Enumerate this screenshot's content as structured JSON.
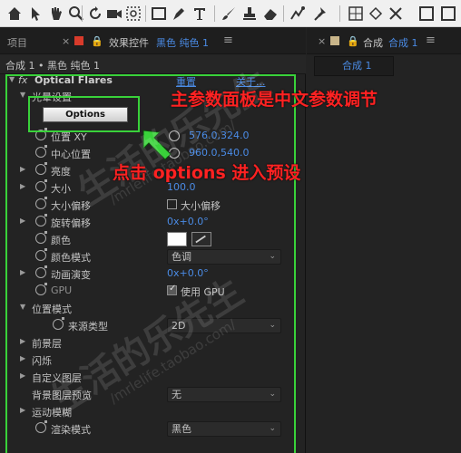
{
  "toolbar": {
    "tools": [
      "home-icon",
      "hand-icon",
      "zoom-icon",
      "rotate-icon",
      "camera-icon",
      "pan-behind-icon",
      "rectangle-icon",
      "pen-icon",
      "text-icon",
      "brush-icon",
      "clone-stamp-icon",
      "eraser-icon",
      "roto-brush-icon",
      "puppet-pin-icon"
    ]
  },
  "left_panel": {
    "tab_project": "项目",
    "tab_close": "×",
    "tab_effects": "效果控件",
    "tab_layer": "黑色 纯色 1",
    "tab_menu": "≡",
    "breadcrumb": "合成 1 • 黑色 纯色 1",
    "effect": {
      "fx": "fx",
      "name": "Optical Flares",
      "reset": "重置",
      "about": "关于..."
    },
    "rows": {
      "flare_settings": "光晕设置",
      "options_button": "Options",
      "position_xy": "位置 XY",
      "position_xy_value": "576.0,324.0",
      "center_position": "中心位置",
      "center_position_value": "960.0,540.0",
      "brightness": "亮度",
      "size": "大小",
      "size_value": "100.0",
      "size_offset": "大小偏移",
      "size_offset_checkbox": "大小偏移",
      "rotation_offset": "旋转偏移",
      "rotation_offset_value": "0x+0.0°",
      "color": "颜色",
      "color_mode": "颜色模式",
      "color_mode_value": "色调",
      "animation_evolution": "动画演变",
      "animation_evolution_value": "0x+0.0°",
      "gpu": "GPU",
      "gpu_checkbox": "使用 GPU",
      "positioning_mode": "位置模式",
      "source_type": "来源类型",
      "source_type_value": "2D",
      "foreground_layers": "前景层",
      "flicker": "闪烁",
      "custom_layer": "自定义图层",
      "background_preview": "背景图层预览",
      "background_preview_value": "无",
      "motion_blur": "运动模糊",
      "render_mode": "渲染模式",
      "render_mode_value": "黑色"
    }
  },
  "right_panel": {
    "tab_close": "×",
    "tab_label": "合成",
    "tab_comp": "合成 1",
    "tab_menu": "≡",
    "sub_tab": "合成 1"
  },
  "annotations": {
    "main_note": "主参数面板是中文参数调节",
    "options_note": "点击 options 进入预设"
  },
  "watermarks": {
    "text_1": "生活的乐先生",
    "url_1": "/mrlelife.taobao.com/",
    "text_2": "生活的乐先生",
    "url_2": "/mrlelife.taobao.com/"
  },
  "colors": {
    "highlight_green": "#39d23a",
    "annotation_red": "#ff2222",
    "link_blue": "#4a8be5",
    "panel_bg": "#232323"
  }
}
